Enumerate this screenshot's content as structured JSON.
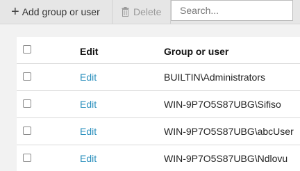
{
  "toolbar": {
    "add_label": "Add group or user",
    "delete_label": "Delete",
    "search_placeholder": "Search..."
  },
  "table": {
    "headers": {
      "edit": "Edit",
      "name": "Group or user"
    },
    "rows": [
      {
        "edit": "Edit",
        "name": "BUILTIN\\Administrators"
      },
      {
        "edit": "Edit",
        "name": "WIN-9P7O5S87UBG\\Sifiso"
      },
      {
        "edit": "Edit",
        "name": "WIN-9P7O5S87UBG\\abcUser"
      },
      {
        "edit": "Edit",
        "name": "WIN-9P7O5S87UBG\\Ndlovu"
      }
    ]
  },
  "colors": {
    "link": "#2a8fbd",
    "toolbar_bg": "#e6e6e6",
    "disabled_text": "#9a9a9a"
  },
  "icons": {
    "add": "plus-icon",
    "delete": "trash-icon"
  }
}
